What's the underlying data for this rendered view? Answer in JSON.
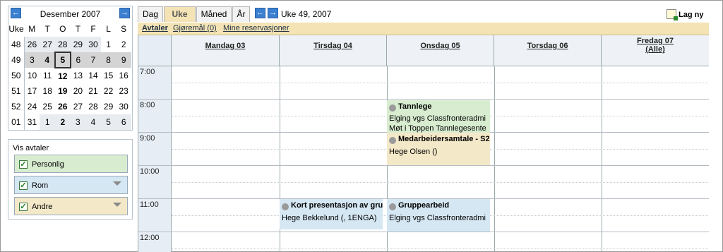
{
  "mini_calendar": {
    "title": "Desember 2007",
    "prev": "←",
    "next": "→",
    "headers": [
      "Uke",
      "M",
      "T",
      "O",
      "T",
      "F",
      "L",
      "S"
    ],
    "weeks": [
      {
        "wk": "48",
        "days": [
          "26",
          "27",
          "28",
          "29",
          "30",
          "1",
          "2"
        ]
      },
      {
        "wk": "49",
        "days": [
          "3",
          "4",
          "5",
          "6",
          "7",
          "8",
          "9"
        ]
      },
      {
        "wk": "50",
        "days": [
          "10",
          "11",
          "12",
          "13",
          "14",
          "15",
          "16"
        ]
      },
      {
        "wk": "51",
        "days": [
          "17",
          "18",
          "19",
          "20",
          "21",
          "22",
          "23"
        ]
      },
      {
        "wk": "52",
        "days": [
          "24",
          "25",
          "26",
          "27",
          "28",
          "29",
          "30"
        ]
      },
      {
        "wk": "01",
        "days": [
          "31",
          "1",
          "2",
          "3",
          "4",
          "5",
          "6"
        ]
      }
    ]
  },
  "vis_avtaler": {
    "title": "Vis avtaler",
    "items": [
      {
        "label": "Personlig",
        "color": "#d8ecd0",
        "checked": true
      },
      {
        "label": "Rom",
        "color": "#d5e7f3",
        "checked": true
      },
      {
        "label": "Andre",
        "color": "#f3e8c8",
        "checked": true
      }
    ]
  },
  "tabs": [
    "Dag",
    "Uke",
    "Måned",
    "År"
  ],
  "nav": {
    "prev": "←",
    "next": "→",
    "week_title": "Uke 49, 2007"
  },
  "lag_ny": "Lag ny",
  "subtabs": [
    "Avtaler",
    "Gjøremål (0)",
    "Mine reservasjoner"
  ],
  "days": [
    "Mandag 03",
    "Tirsdag 04",
    "Onsdag 05",
    "Torsdag 06",
    "Fredag 07"
  ],
  "friday_sub": "(Alle)",
  "times": [
    "7:00",
    "8:00",
    "9:00",
    "10:00",
    "11:00",
    "12:00"
  ],
  "events": {
    "tannlege": {
      "title": "Tannlege",
      "line1": "Elging vgs Classfronteradmi",
      "line2": "Møt i Toppen Tannlegesente"
    },
    "medarbeider": {
      "title": "Medarbeidersamtale - S2",
      "line1": "Hege Olsen ()"
    },
    "kort": {
      "title": "Kort presentasjon av gru",
      "line1": "Hege Bekkelund (, 1ENGA)"
    },
    "gruppe": {
      "title": "Gruppearbeid",
      "line1": "Elging vgs Classfronteradmi"
    }
  },
  "colors": {
    "personal": "#d8ecd0",
    "room": "#d5e7f3",
    "other": "#f3e8c8",
    "accent": "#3b7fd0"
  }
}
